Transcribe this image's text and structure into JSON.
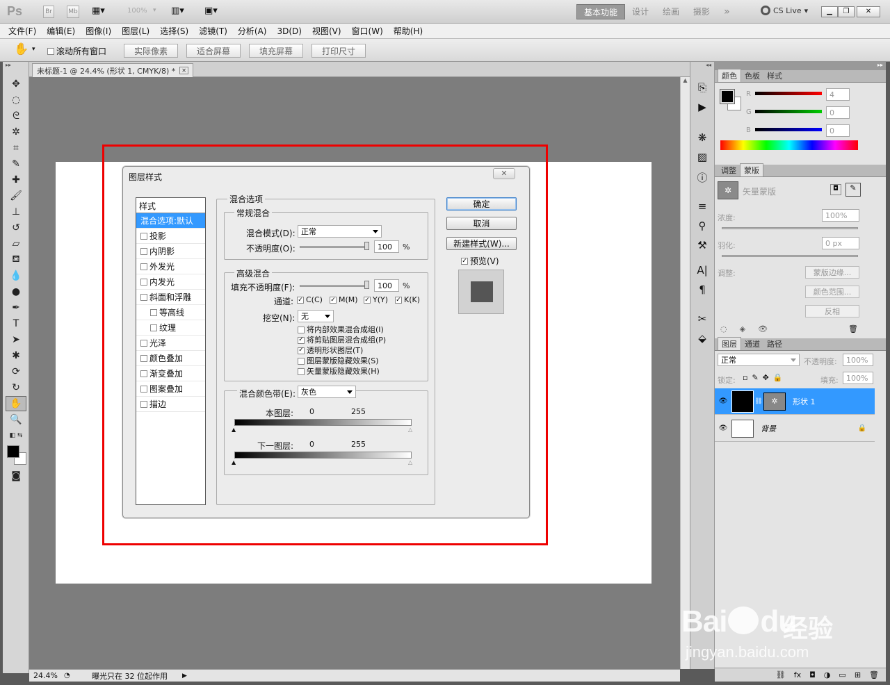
{
  "app": {
    "logo": "Ps",
    "zoom_combo": "100%",
    "workspaces": [
      "基本功能",
      "设计",
      "绘画",
      "摄影"
    ],
    "active_workspace": "基本功能",
    "more": "»",
    "cs_live": "CS Live"
  },
  "menu": [
    "文件(F)",
    "编辑(E)",
    "图像(I)",
    "图层(L)",
    "选择(S)",
    "滤镜(T)",
    "分析(A)",
    "3D(D)",
    "视图(V)",
    "窗口(W)",
    "帮助(H)"
  ],
  "options": {
    "scroll_all_label": "滚动所有窗口",
    "buttons": [
      "实际像素",
      "适合屏幕",
      "填充屏幕",
      "打印尺寸"
    ]
  },
  "document": {
    "tab_title": "未标题-1 @ 24.4% (形状 1, CMYK/8) *",
    "zoom": "24.4%",
    "status": "曝光只在 32 位起作用"
  },
  "dialog": {
    "title": "图层样式",
    "close": "✕",
    "style_header": "样式",
    "style_items": [
      {
        "label": "混合选项:默认",
        "checkbox": false,
        "selected": true,
        "indent": false
      },
      {
        "label": "投影",
        "checkbox": true,
        "selected": false,
        "indent": false
      },
      {
        "label": "内阴影",
        "checkbox": true,
        "selected": false,
        "indent": false
      },
      {
        "label": "外发光",
        "checkbox": true,
        "selected": false,
        "indent": false
      },
      {
        "label": "内发光",
        "checkbox": true,
        "selected": false,
        "indent": false
      },
      {
        "label": "斜面和浮雕",
        "checkbox": true,
        "selected": false,
        "indent": false
      },
      {
        "label": "等高线",
        "checkbox": true,
        "selected": false,
        "indent": true
      },
      {
        "label": "纹理",
        "checkbox": true,
        "selected": false,
        "indent": true
      },
      {
        "label": "光泽",
        "checkbox": true,
        "selected": false,
        "indent": false
      },
      {
        "label": "颜色叠加",
        "checkbox": true,
        "selected": false,
        "indent": false
      },
      {
        "label": "渐变叠加",
        "checkbox": true,
        "selected": false,
        "indent": false
      },
      {
        "label": "图案叠加",
        "checkbox": true,
        "selected": false,
        "indent": false
      },
      {
        "label": "描边",
        "checkbox": true,
        "selected": false,
        "indent": false
      }
    ],
    "blend_options_title": "混合选项",
    "general": {
      "title": "常规混合",
      "mode_label": "混合模式(D):",
      "mode_value": "正常",
      "opacity_label": "不透明度(O):",
      "opacity_value": "100",
      "percent": "%"
    },
    "advanced": {
      "title": "高级混合",
      "fill_label": "填充不透明度(F):",
      "fill_value": "100",
      "percent": "%",
      "channels_label": "通道:",
      "channels": [
        "C(C)",
        "M(M)",
        "Y(Y)",
        "K(K)"
      ],
      "knockout_label": "挖空(N):",
      "knockout_value": "无",
      "options": [
        {
          "label": "将内部效果混合成组(I)",
          "checked": false
        },
        {
          "label": "将剪贴图层混合成组(P)",
          "checked": true
        },
        {
          "label": "透明形状图层(T)",
          "checked": true
        },
        {
          "label": "图层蒙版隐藏效果(S)",
          "checked": false
        },
        {
          "label": "矢量蒙版隐藏效果(H)",
          "checked": false
        }
      ]
    },
    "blend_if": {
      "label": "混合颜色带(E):",
      "value": "灰色",
      "this_layer": "本图层:",
      "underlying": "下一图层:",
      "min": "0",
      "max": "255"
    },
    "buttons": {
      "ok": "确定",
      "cancel": "取消",
      "new_style": "新建样式(W)...",
      "preview": "预览(V)"
    }
  },
  "color_panel": {
    "tabs": [
      "颜色",
      "色板",
      "样式"
    ],
    "r_label": "R",
    "g_label": "G",
    "b_label": "B",
    "r": "4",
    "g": "0",
    "b": "0"
  },
  "adjust_panel": {
    "tabs": [
      "调整",
      "蒙版"
    ],
    "mask_title": "矢量蒙版",
    "density_label": "浓度:",
    "density_value": "100%",
    "feather_label": "羽化:",
    "feather_value": "0 px",
    "refine_label": "调整:",
    "buttons": [
      "蒙版边缘...",
      "颜色范围...",
      "反相"
    ]
  },
  "layers_panel": {
    "tabs": [
      "图层",
      "通道",
      "路径"
    ],
    "blend_mode": "正常",
    "opacity_label": "不透明度:",
    "opacity": "100%",
    "lock_label": "锁定:",
    "fill_label": "填充:",
    "fill": "100%",
    "layers": [
      {
        "name": "形状 1",
        "selected": true
      },
      {
        "name": "背景",
        "selected": false
      }
    ]
  },
  "watermark": {
    "brand": "Bai",
    "brand2": "du",
    "cn": "经验",
    "url": "jingyan.baidu.com"
  },
  "colors": {
    "accent": "#3399ff",
    "highlight": "#ee0000"
  }
}
